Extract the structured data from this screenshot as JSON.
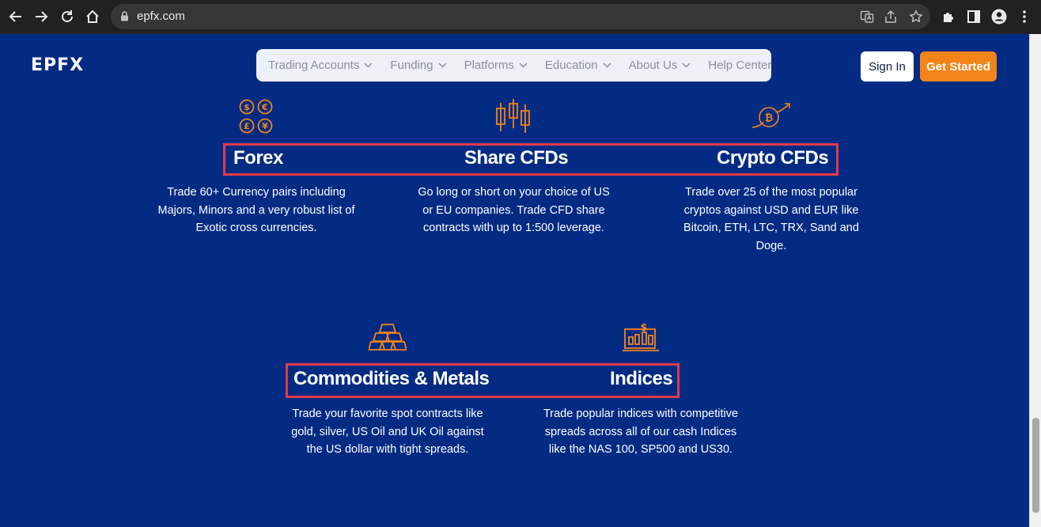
{
  "browser": {
    "url": "epfx.com"
  },
  "header": {
    "logo": "EPFX",
    "nav": [
      {
        "label": "Trading Accounts",
        "dropdown": true
      },
      {
        "label": "Funding",
        "dropdown": true
      },
      {
        "label": "Platforms",
        "dropdown": true
      },
      {
        "label": "Education",
        "dropdown": true
      },
      {
        "label": "About Us",
        "dropdown": true
      },
      {
        "label": "Help Center",
        "dropdown": false
      }
    ],
    "sign_in": "Sign In",
    "get_started": "Get Started"
  },
  "products": [
    {
      "title": "Forex",
      "icon": "currency-exchange-icon",
      "description": "Trade 60+ Currency pairs including Majors, Minors and a very robust list of Exotic cross currencies."
    },
    {
      "title": "Share CFDs",
      "icon": "candlestick-chart-icon",
      "description": "Go long or short on your choice of US or EU companies. Trade CFD share contracts with up to 1:500 leverage."
    },
    {
      "title": "Crypto CFDs",
      "icon": "bitcoin-growth-icon",
      "description": "Trade over 25 of the most popular cryptos against USD and EUR like Bitcoin, ETH, LTC, TRX, Sand and Doge."
    },
    {
      "title": "Commodities & Metals",
      "icon": "gold-bars-icon",
      "description": "Trade your favorite spot contracts like gold, silver, US Oil and UK Oil against the US dollar with tight spreads."
    },
    {
      "title": "Indices",
      "icon": "index-chart-icon",
      "description": "Trade popular indices with competitive spreads across all of our cash Indices like the NAS 100, SP500 and US30."
    }
  ],
  "colors": {
    "background": "#032b83",
    "accent": "#f3841a",
    "highlight": "#e33a4c"
  }
}
